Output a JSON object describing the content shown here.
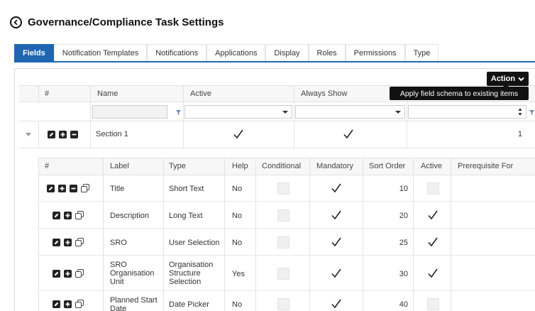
{
  "page": {
    "title": "Governance/Compliance Task Settings"
  },
  "tabs": [
    "Fields",
    "Notification Templates",
    "Notifications",
    "Applications",
    "Display",
    "Roles",
    "Permissions",
    "Type"
  ],
  "action": {
    "label": "Action",
    "tooltip": "Apply field schema to existing items"
  },
  "outer_grid": {
    "headers": {
      "hash": "#",
      "name": "Name",
      "active": "Active",
      "always_show": "Always Show"
    },
    "section": {
      "name": "Section 1",
      "active": true,
      "always_show": true,
      "count": "1"
    }
  },
  "inner_grid": {
    "headers": {
      "hash": "#",
      "label": "Label",
      "type": "Type",
      "help": "Help",
      "conditional": "Conditional",
      "mandatory": "Mandatory",
      "sort_order": "Sort Order",
      "active": "Active",
      "prerequisite": "Prerequisite For"
    },
    "rows": [
      {
        "label": "Title",
        "type": "Short Text",
        "help": "No",
        "mandatory": true,
        "sort": "10",
        "active": false,
        "minus": true
      },
      {
        "label": "Description",
        "type": "Long Text",
        "help": "No",
        "mandatory": true,
        "sort": "20",
        "active": true,
        "minus": false
      },
      {
        "label": "SRO",
        "type": "User Selection",
        "help": "No",
        "mandatory": true,
        "sort": "25",
        "active": true,
        "minus": false
      },
      {
        "label": "SRO Organisation Unit",
        "type": "Organisation Structure Selection",
        "help": "Yes",
        "mandatory": true,
        "sort": "30",
        "active": true,
        "minus": false
      },
      {
        "label": "Planned Start Date",
        "type": "Date Picker",
        "help": "No",
        "mandatory": true,
        "sort": "40",
        "active": false,
        "minus": false
      }
    ]
  },
  "colors": {
    "accent": "#1f66b1",
    "dark": "#111111"
  }
}
